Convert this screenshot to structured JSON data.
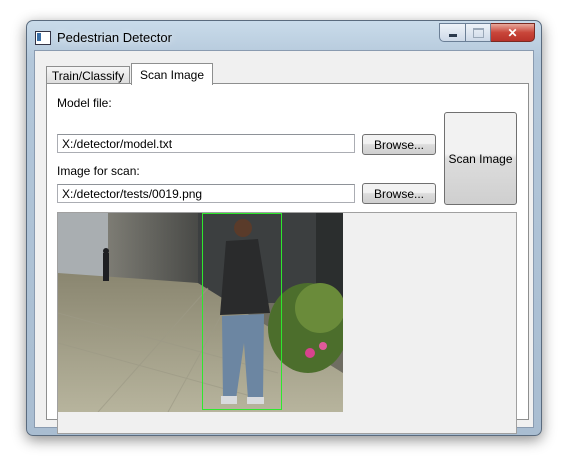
{
  "window": {
    "title": "Pedestrian Detector",
    "close_glyph": "✕"
  },
  "icons": {
    "app": "app-window-icon",
    "minimize": "minimize-icon",
    "maximize": "maximize-icon",
    "close": "close-icon"
  },
  "tabs": [
    {
      "label": "Train/Classify",
      "selected": false
    },
    {
      "label": "Scan Image",
      "selected": true
    }
  ],
  "form": {
    "model_label": "Model file:",
    "model_value": "X:/detector/model.txt",
    "image_label": "Image for scan:",
    "image_value": "X:/detector/tests/0019.png",
    "browse_label": "Browse...",
    "scan_label": "Scan Image"
  },
  "colors": {
    "detection_box": "#2ee82e"
  }
}
